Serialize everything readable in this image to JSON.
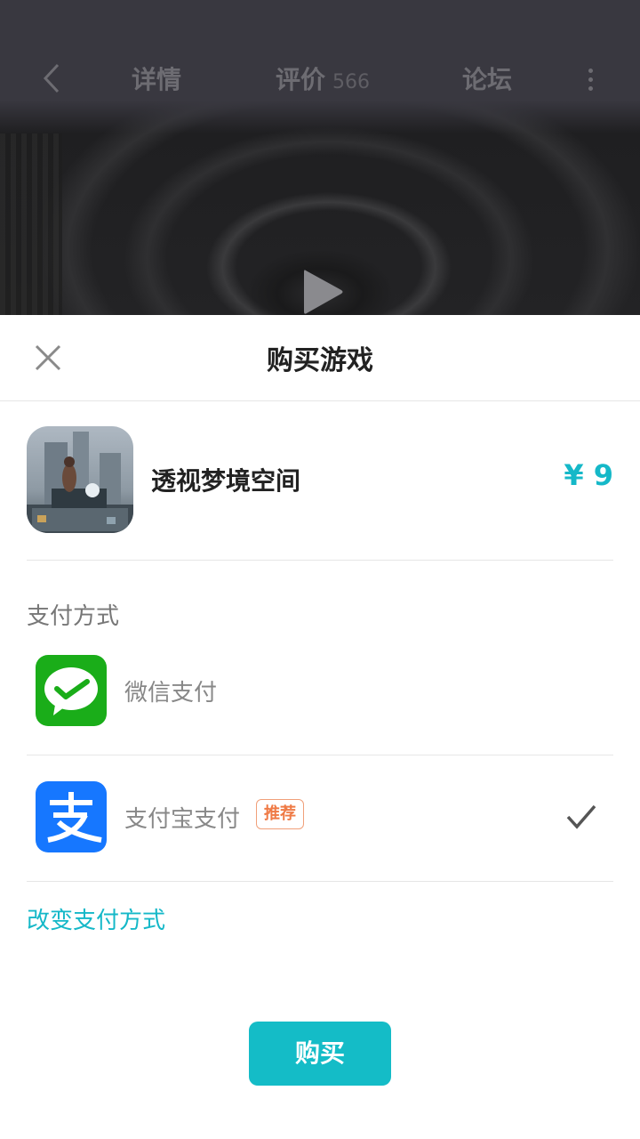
{
  "nav": {
    "tabs": [
      {
        "label": "详情"
      },
      {
        "label": "评价",
        "count": "566"
      },
      {
        "label": "论坛"
      }
    ]
  },
  "sheet": {
    "title": "购买游戏",
    "product": {
      "name": "透视梦境空间",
      "price": "¥ 9"
    },
    "payment_label": "支付方式",
    "methods": [
      {
        "name": "微信支付",
        "selected": false,
        "icon": "wechat-pay-icon"
      },
      {
        "name": "支付宝支付",
        "badge": "推荐",
        "selected": true,
        "icon": "alipay-icon"
      }
    ],
    "change_payment": "改变支付方式",
    "buy_label": "购买"
  },
  "colors": {
    "accent": "#14bcc7",
    "wechat": "#1aad19",
    "alipay": "#1677ff",
    "badge": "#ef7a45"
  }
}
